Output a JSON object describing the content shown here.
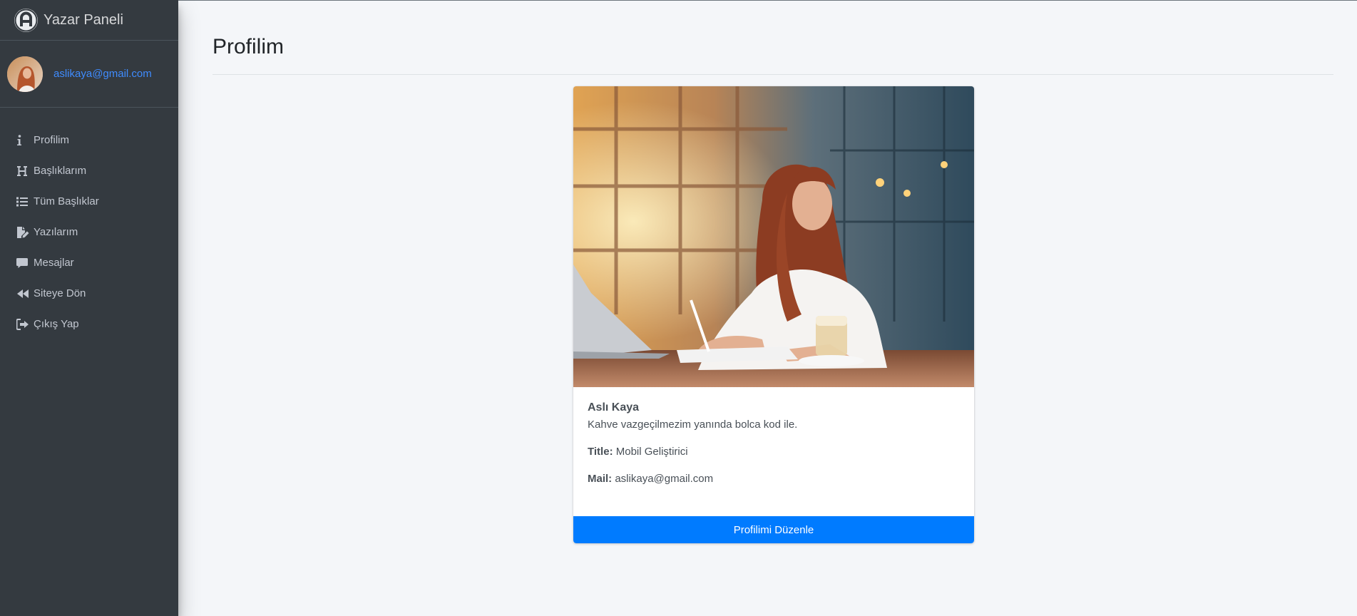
{
  "app": {
    "title": "Yazar Paneli"
  },
  "user": {
    "email": "aslikaya@gmail.com"
  },
  "nav": {
    "items": [
      {
        "label": "Profilim",
        "icon": "info-icon"
      },
      {
        "label": "Başlıklarım",
        "icon": "heading-icon"
      },
      {
        "label": "Tüm Başlıklar",
        "icon": "list-icon"
      },
      {
        "label": "Yazılarım",
        "icon": "file-edit-icon"
      },
      {
        "label": "Mesajlar",
        "icon": "comment-icon"
      },
      {
        "label": "Siteye Dön",
        "icon": "backward-icon"
      },
      {
        "label": "Çıkış Yap",
        "icon": "sign-out-icon"
      }
    ]
  },
  "page": {
    "title": "Profilim"
  },
  "profile": {
    "name": "Aslı Kaya",
    "bio": "Kahve vazgeçilmezim yanında bolca kod ile.",
    "title_label": "Title:",
    "title_value": "Mobil Geliştirici",
    "mail_label": "Mail:",
    "mail_value": "aslikaya@gmail.com",
    "edit_button": "Profilimi Düzenle"
  },
  "colors": {
    "sidebar_bg": "#343a40",
    "content_bg": "#f4f6f9",
    "link": "#3f8cff",
    "primary": "#007bff"
  }
}
